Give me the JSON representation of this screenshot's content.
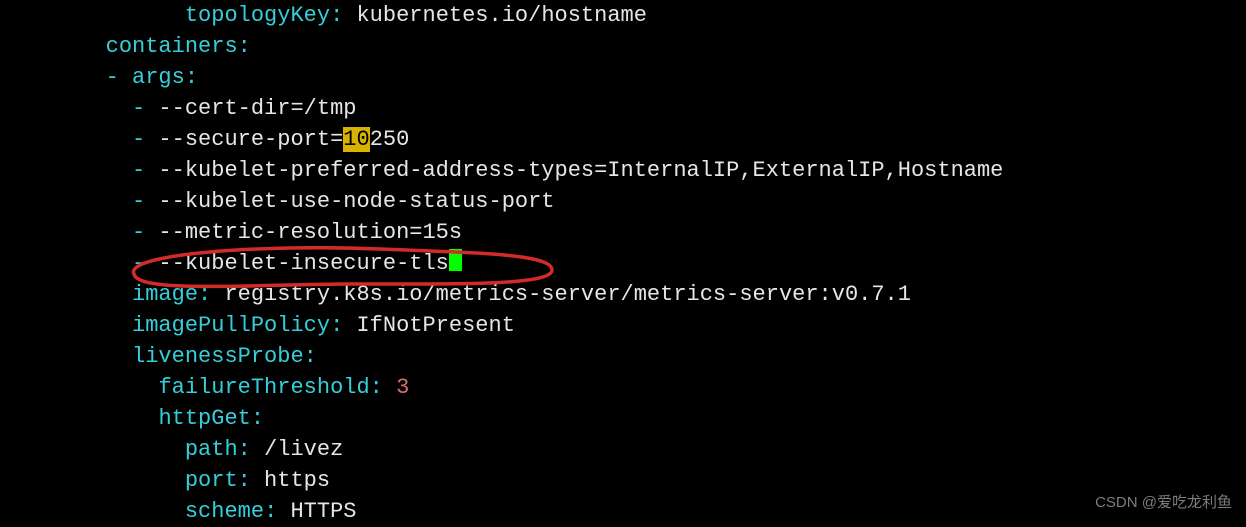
{
  "indent0": "              ",
  "indent1": "        ",
  "indent2": "          ",
  "indent3": "            ",
  "indent4": "              ",
  "l1": {
    "key": "topologyKey",
    "val": " kubernetes.io/hostname"
  },
  "l2": {
    "key": "containers"
  },
  "l3": {
    "dash": "-",
    "key": " args"
  },
  "l4": {
    "dash": "-",
    "val": " --cert-dir=/tmp"
  },
  "l5": {
    "dash": "-",
    "val_a": " --secure-port=",
    "hl": "10",
    "val_b": "250"
  },
  "l6": {
    "dash": "-",
    "val": " --kubelet-preferred-address-types=InternalIP,ExternalIP,Hostname"
  },
  "l7": {
    "dash": "-",
    "val": " --kubelet-use-node-status-port"
  },
  "l8": {
    "dash": "-",
    "val": " --metric-resolution=15s"
  },
  "l9": {
    "dash": "-",
    "val": " --kubelet-insecure-tls"
  },
  "l10": {
    "key": "image",
    "val": " registry.k8s.io/metrics-server/metrics-server:v0.7.1"
  },
  "l11": {
    "key": "imagePullPolicy",
    "val": " IfNotPresent"
  },
  "l12": {
    "key": "livenessProbe"
  },
  "l13": {
    "key": "failureThreshold",
    "val": " ",
    "num": "3"
  },
  "l14": {
    "key": "httpGet"
  },
  "l15": {
    "key": "path",
    "val": " /livez"
  },
  "l16": {
    "key": "port",
    "val": " https"
  },
  "l17": {
    "key": "scheme",
    "val": " HTTPS"
  },
  "watermark": "CSDN @爱吃龙利鱼"
}
